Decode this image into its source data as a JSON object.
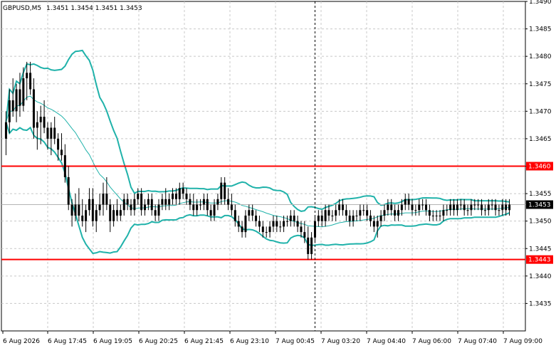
{
  "header": {
    "symbol": "GBPUSD,M5",
    "ohlc": "1.3451 1.3454 1.3451 1.3453"
  },
  "chart_data": {
    "type": "candlestick",
    "symbol": "GBPUSD",
    "timeframe": "M5",
    "ylim": [
      1.343,
      1.349
    ],
    "y_ticks": [
      "1.3490",
      "1.3485",
      "1.3480",
      "1.3475",
      "1.3470",
      "1.3465",
      "1.3460",
      "1.3455",
      "1.3450",
      "1.3445",
      "1.3440",
      "1.3435"
    ],
    "x_ticks": [
      "6 Aug 2026",
      "6 Aug 17:45",
      "6 Aug 19:05",
      "6 Aug 20:25",
      "6 Aug 21:45",
      "6 Aug 23:10",
      "7 Aug 00:45",
      "7 Aug 03:20",
      "7 Aug 04:40",
      "7 Aug 06:00",
      "7 Aug 07:40",
      "7 Aug 09:00"
    ],
    "grid": true,
    "horizontal_levels": [
      {
        "value": 1.346,
        "label": "1.3460",
        "color": "#ff0000"
      },
      {
        "value": 1.3443,
        "label": "1.3443",
        "color": "#ff0000"
      }
    ],
    "current_price": {
      "value": 1.3453,
      "label": "1.3453",
      "color": "#000000"
    },
    "crosshair_x_index": 89,
    "indicator": "Bollinger Bands",
    "indicator_color": "#20b2aa",
    "candle_color": "#000000",
    "candles": [
      [
        1.3465,
        1.347,
        1.3462,
        1.3468
      ],
      [
        1.3468,
        1.3474,
        1.3466,
        1.3472
      ],
      [
        1.3472,
        1.3476,
        1.3469,
        1.347
      ],
      [
        1.347,
        1.3475,
        1.3468,
        1.3474
      ],
      [
        1.3474,
        1.3477,
        1.3469,
        1.3471
      ],
      [
        1.3471,
        1.3478,
        1.347,
        1.3476
      ],
      [
        1.3476,
        1.3479,
        1.3472,
        1.3477
      ],
      [
        1.3477,
        1.3479,
        1.3473,
        1.3474
      ],
      [
        1.3474,
        1.3476,
        1.3465,
        1.3467
      ],
      [
        1.3467,
        1.347,
        1.3463,
        1.3468
      ],
      [
        1.3468,
        1.3471,
        1.3464,
        1.3469
      ],
      [
        1.3469,
        1.3472,
        1.3466,
        1.3467
      ],
      [
        1.3467,
        1.3468,
        1.3463,
        1.3465
      ],
      [
        1.3465,
        1.3468,
        1.3462,
        1.3467
      ],
      [
        1.3467,
        1.3469,
        1.3464,
        1.3465
      ],
      [
        1.3465,
        1.3466,
        1.3461,
        1.3463
      ],
      [
        1.3463,
        1.3466,
        1.3461,
        1.3462
      ],
      [
        1.3462,
        1.3464,
        1.3457,
        1.3458
      ],
      [
        1.3458,
        1.346,
        1.3452,
        1.3453
      ],
      [
        1.3453,
        1.3454,
        1.3449,
        1.3451
      ],
      [
        1.3451,
        1.3455,
        1.345,
        1.3453
      ],
      [
        1.3453,
        1.3456,
        1.345,
        1.3451
      ],
      [
        1.3451,
        1.3454,
        1.3449,
        1.345
      ],
      [
        1.345,
        1.3453,
        1.3448,
        1.3452
      ],
      [
        1.3452,
        1.3456,
        1.3451,
        1.3454
      ],
      [
        1.3454,
        1.3456,
        1.3449,
        1.345
      ],
      [
        1.345,
        1.3453,
        1.3448,
        1.3452
      ],
      [
        1.3452,
        1.3455,
        1.3451,
        1.3453
      ],
      [
        1.3453,
        1.3457,
        1.3451,
        1.3455
      ],
      [
        1.3455,
        1.3458,
        1.3452,
        1.3453
      ],
      [
        1.3453,
        1.3454,
        1.3448,
        1.345
      ],
      [
        1.345,
        1.3453,
        1.3449,
        1.3452
      ],
      [
        1.3452,
        1.3454,
        1.345,
        1.3451
      ],
      [
        1.3451,
        1.3453,
        1.345,
        1.3452
      ],
      [
        1.3452,
        1.3455,
        1.3451,
        1.3454
      ],
      [
        1.3454,
        1.3455,
        1.3452,
        1.3453
      ],
      [
        1.3453,
        1.3454,
        1.3451,
        1.3452
      ],
      [
        1.3452,
        1.3455,
        1.3451,
        1.3454
      ],
      [
        1.3454,
        1.3456,
        1.3453,
        1.3455
      ],
      [
        1.3455,
        1.3456,
        1.3451,
        1.3452
      ],
      [
        1.3452,
        1.3454,
        1.3451,
        1.3453
      ],
      [
        1.3453,
        1.3455,
        1.3452,
        1.3454
      ],
      [
        1.3454,
        1.3455,
        1.3451,
        1.3452
      ],
      [
        1.3452,
        1.3453,
        1.345,
        1.3451
      ],
      [
        1.3451,
        1.3454,
        1.345,
        1.3453
      ],
      [
        1.3453,
        1.3455,
        1.3452,
        1.3454
      ],
      [
        1.3454,
        1.3456,
        1.3452,
        1.3453
      ],
      [
        1.3453,
        1.3455,
        1.3452,
        1.3454
      ],
      [
        1.3454,
        1.3456,
        1.3453,
        1.3455
      ],
      [
        1.3455,
        1.3456,
        1.3453,
        1.3454
      ],
      [
        1.3454,
        1.3457,
        1.3453,
        1.3456
      ],
      [
        1.3456,
        1.3457,
        1.3454,
        1.3455
      ],
      [
        1.3455,
        1.3456,
        1.3453,
        1.3454
      ],
      [
        1.3454,
        1.3455,
        1.3452,
        1.3453
      ],
      [
        1.3453,
        1.3455,
        1.3451,
        1.3452
      ],
      [
        1.3452,
        1.3454,
        1.3451,
        1.3453
      ],
      [
        1.3453,
        1.3454,
        1.3452,
        1.3453
      ],
      [
        1.3453,
        1.3455,
        1.3452,
        1.3454
      ],
      [
        1.3454,
        1.3455,
        1.3451,
        1.3452
      ],
      [
        1.3452,
        1.3453,
        1.345,
        1.3451
      ],
      [
        1.3451,
        1.3454,
        1.345,
        1.3453
      ],
      [
        1.3453,
        1.3455,
        1.3452,
        1.3454
      ],
      [
        1.3454,
        1.3458,
        1.3453,
        1.3457
      ],
      [
        1.3457,
        1.3458,
        1.3453,
        1.3454
      ],
      [
        1.3454,
        1.3456,
        1.3452,
        1.3453
      ],
      [
        1.3453,
        1.3455,
        1.3451,
        1.3452
      ],
      [
        1.3452,
        1.3453,
        1.3449,
        1.345
      ],
      [
        1.345,
        1.3451,
        1.3448,
        1.3449
      ],
      [
        1.3449,
        1.345,
        1.3447,
        1.3448
      ],
      [
        1.3448,
        1.3452,
        1.3447,
        1.3451
      ],
      [
        1.3451,
        1.3453,
        1.345,
        1.3452
      ],
      [
        1.3452,
        1.3453,
        1.345,
        1.3451
      ],
      [
        1.3451,
        1.3452,
        1.3449,
        1.345
      ],
      [
        1.345,
        1.3451,
        1.3448,
        1.3449
      ],
      [
        1.3449,
        1.345,
        1.3447,
        1.3448
      ],
      [
        1.3448,
        1.3449,
        1.3447,
        1.3448
      ],
      [
        1.3448,
        1.345,
        1.3447,
        1.3449
      ],
      [
        1.3449,
        1.3451,
        1.3448,
        1.345
      ],
      [
        1.345,
        1.3451,
        1.3448,
        1.3449
      ],
      [
        1.3449,
        1.345,
        1.3448,
        1.3449
      ],
      [
        1.3449,
        1.3451,
        1.3448,
        1.345
      ],
      [
        1.345,
        1.3451,
        1.3449,
        1.345
      ],
      [
        1.345,
        1.3452,
        1.3449,
        1.3451
      ],
      [
        1.3451,
        1.3452,
        1.3449,
        1.345
      ],
      [
        1.345,
        1.3451,
        1.3448,
        1.3449
      ],
      [
        1.3449,
        1.345,
        1.3447,
        1.3448
      ],
      [
        1.3448,
        1.345,
        1.3446,
        1.3447
      ],
      [
        1.3447,
        1.3449,
        1.3443,
        1.3444
      ],
      [
        1.3444,
        1.3448,
        1.3443,
        1.3447
      ],
      [
        1.3447,
        1.3451,
        1.3446,
        1.345
      ],
      [
        1.345,
        1.3452,
        1.3449,
        1.3451
      ],
      [
        1.3451,
        1.3452,
        1.3449,
        1.345
      ],
      [
        1.345,
        1.3453,
        1.3449,
        1.3452
      ],
      [
        1.3452,
        1.3453,
        1.345,
        1.3451
      ],
      [
        1.3451,
        1.3452,
        1.345,
        1.3451
      ],
      [
        1.3451,
        1.3453,
        1.345,
        1.3452
      ],
      [
        1.3452,
        1.3454,
        1.3451,
        1.3453
      ],
      [
        1.3453,
        1.3454,
        1.3451,
        1.3452
      ],
      [
        1.3452,
        1.3453,
        1.345,
        1.3451
      ],
      [
        1.3451,
        1.3452,
        1.3449,
        1.345
      ],
      [
        1.345,
        1.3452,
        1.3449,
        1.3451
      ],
      [
        1.3451,
        1.3452,
        1.345,
        1.3451
      ],
      [
        1.3451,
        1.3453,
        1.345,
        1.3452
      ],
      [
        1.3452,
        1.3453,
        1.3451,
        1.3452
      ],
      [
        1.3452,
        1.3453,
        1.345,
        1.3451
      ],
      [
        1.3451,
        1.3452,
        1.3449,
        1.345
      ],
      [
        1.345,
        1.3451,
        1.3448,
        1.3449
      ],
      [
        1.3449,
        1.3451,
        1.3447,
        1.345
      ],
      [
        1.345,
        1.3452,
        1.3449,
        1.3451
      ],
      [
        1.3451,
        1.3453,
        1.345,
        1.3452
      ],
      [
        1.3452,
        1.3454,
        1.3451,
        1.3453
      ],
      [
        1.3453,
        1.3454,
        1.3451,
        1.3452
      ],
      [
        1.3452,
        1.3453,
        1.345,
        1.3451
      ],
      [
        1.3451,
        1.3453,
        1.345,
        1.3452
      ],
      [
        1.3452,
        1.3454,
        1.3451,
        1.3453
      ],
      [
        1.3453,
        1.3455,
        1.3452,
        1.3454
      ],
      [
        1.3454,
        1.3455,
        1.3452,
        1.3453
      ],
      [
        1.3453,
        1.3454,
        1.3451,
        1.3452
      ],
      [
        1.3452,
        1.3453,
        1.3451,
        1.3452
      ],
      [
        1.3452,
        1.3454,
        1.3451,
        1.3453
      ],
      [
        1.3453,
        1.3454,
        1.3452,
        1.3453
      ],
      [
        1.3453,
        1.3454,
        1.3451,
        1.3452
      ],
      [
        1.3452,
        1.3453,
        1.345,
        1.3451
      ],
      [
        1.3451,
        1.3452,
        1.345,
        1.3451
      ],
      [
        1.3451,
        1.3452,
        1.345,
        1.3451
      ],
      [
        1.3451,
        1.3452,
        1.345,
        1.3451
      ],
      [
        1.3451,
        1.3453,
        1.345,
        1.3452
      ],
      [
        1.3452,
        1.3453,
        1.3451,
        1.3452
      ],
      [
        1.3452,
        1.3454,
        1.3451,
        1.3453
      ],
      [
        1.3453,
        1.3454,
        1.3451,
        1.3452
      ],
      [
        1.3452,
        1.3454,
        1.3451,
        1.3453
      ],
      [
        1.3453,
        1.3454,
        1.3452,
        1.3453
      ],
      [
        1.3453,
        1.3454,
        1.3451,
        1.3452
      ],
      [
        1.3452,
        1.3453,
        1.3451,
        1.3452
      ],
      [
        1.3452,
        1.3454,
        1.3451,
        1.3453
      ],
      [
        1.3453,
        1.3454,
        1.3452,
        1.3453
      ],
      [
        1.3453,
        1.3454,
        1.3452,
        1.3453
      ],
      [
        1.3453,
        1.3454,
        1.3451,
        1.3452
      ],
      [
        1.3452,
        1.3453,
        1.3451,
        1.3452
      ],
      [
        1.3452,
        1.3454,
        1.3451,
        1.3453
      ],
      [
        1.3453,
        1.3454,
        1.3452,
        1.3453
      ],
      [
        1.3453,
        1.3454,
        1.3451,
        1.3452
      ],
      [
        1.3452,
        1.3453,
        1.3451,
        1.3452
      ],
      [
        1.3452,
        1.3454,
        1.3451,
        1.3453
      ],
      [
        1.3453,
        1.3454,
        1.3451,
        1.3452
      ],
      [
        1.3452,
        1.3454,
        1.3451,
        1.3453
      ]
    ]
  }
}
